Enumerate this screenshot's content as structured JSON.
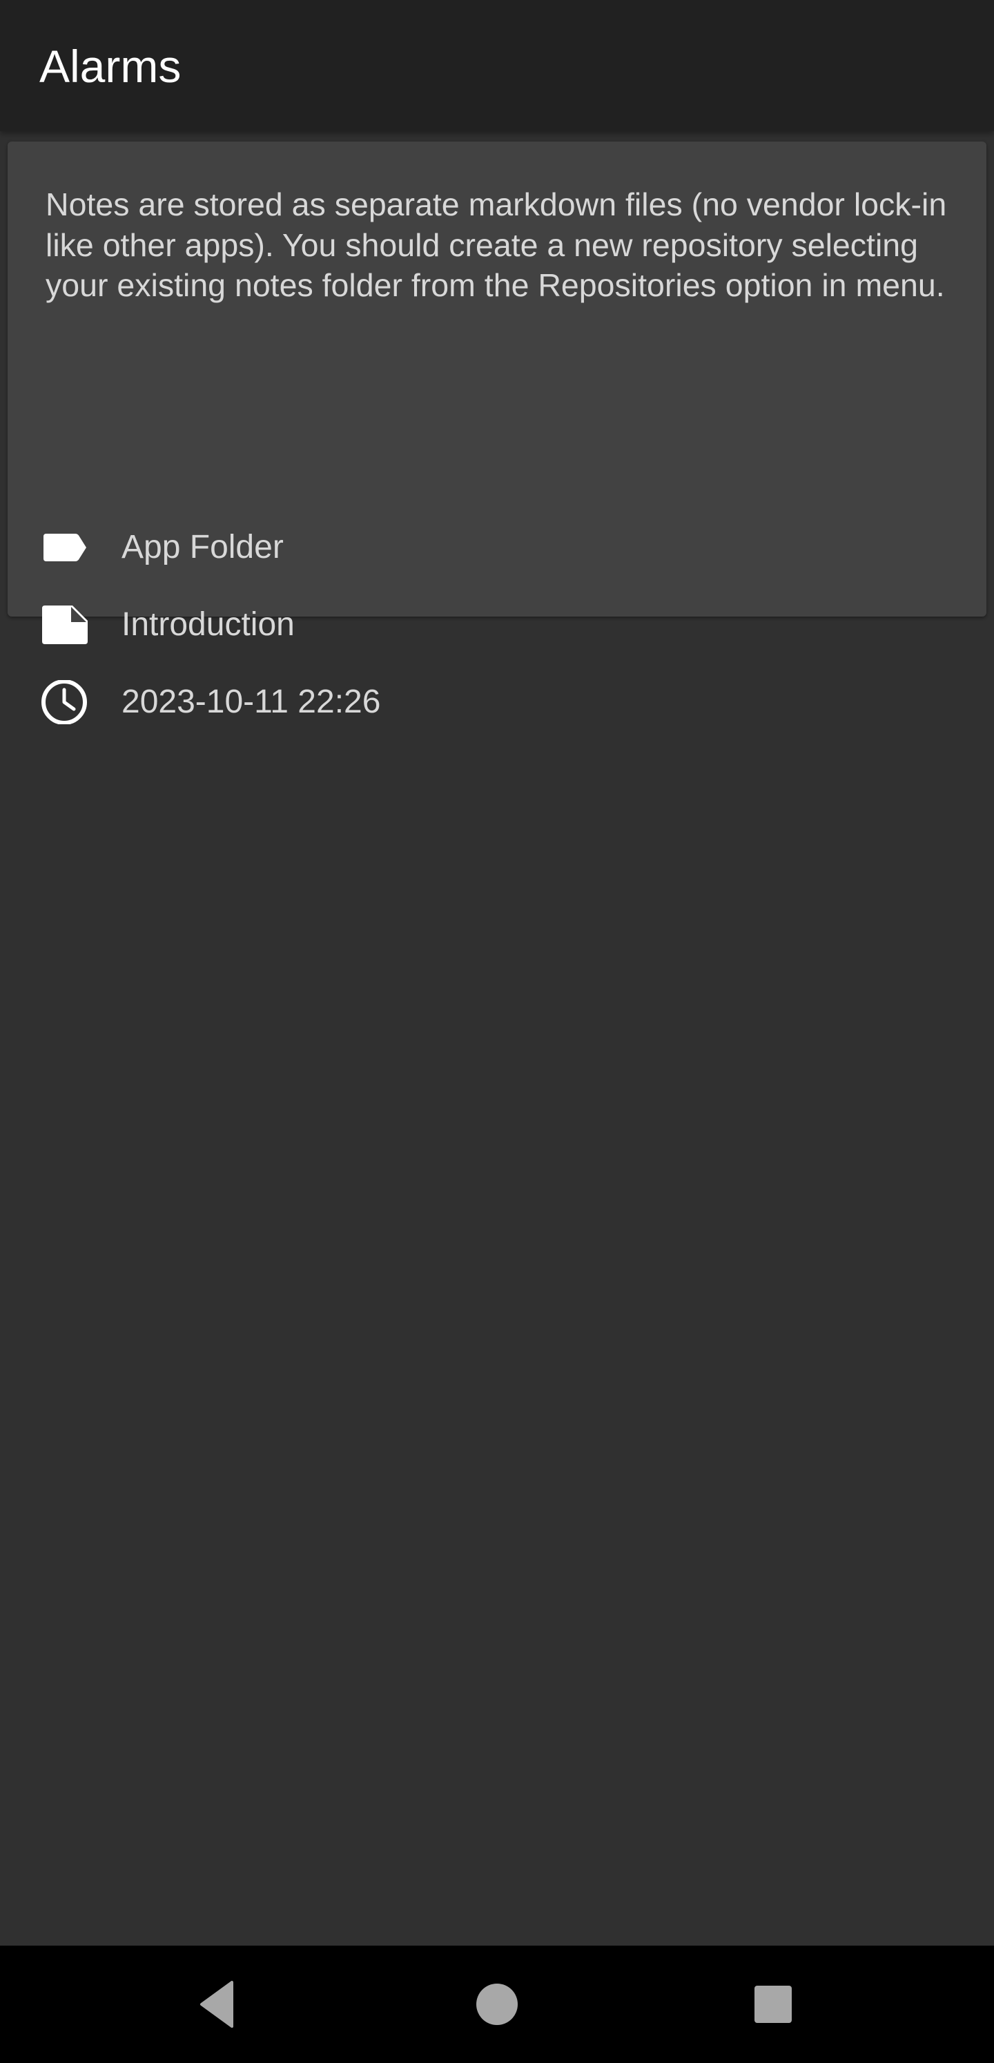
{
  "app_bar": {
    "title": "Alarms"
  },
  "note_card": {
    "text": "Notes are stored as separate markdown files (no vendor lock-in like other apps). You should create a new repository selecting your existing notes folder from the Repositories option in menu.",
    "folder_icon": "label-icon",
    "folder": "App Folder",
    "notebook_icon": "note-icon",
    "notebook": "Introduction",
    "alarm_icon": "clock-icon",
    "alarm_time": "2023-10-11 22:26"
  },
  "nav_bar": {
    "back_icon": "back-triangle-icon",
    "home_icon": "home-circle-icon",
    "recents_icon": "recents-square-icon"
  },
  "colors": {
    "app_bar_bg": "#212121",
    "background": "#303030",
    "card_bg": "#424242",
    "text": "#d8d8d8",
    "nav_bg": "#000000"
  }
}
